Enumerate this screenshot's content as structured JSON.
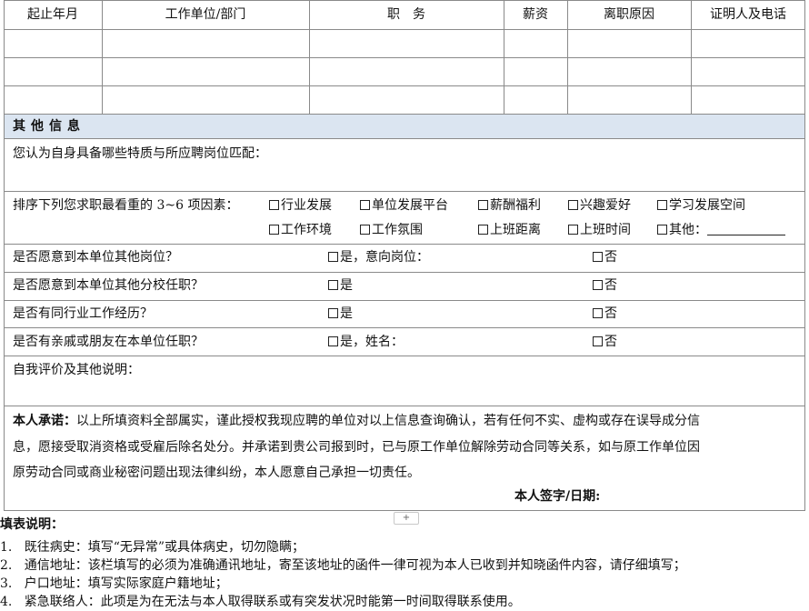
{
  "header_row": {
    "start_date": "起止年月",
    "employer": "工作单位/部门",
    "position": "职　务",
    "salary": "薪资",
    "leave_reason": "离职原因",
    "reference": "证明人及电话"
  },
  "other_info": {
    "title": "其他信息",
    "traits_question": "您认为自身具备哪些特质与所应聘岗位匹配：",
    "factors_question": "排序下列您求职最看重的 3~6 项因素：",
    "factors_row1": [
      "行业发展",
      "单位发展平台",
      "薪酬福利",
      "兴趣爱好",
      "学习发展空间"
    ],
    "factors_row2": [
      "工作环境",
      "工作氛围",
      "上班距离",
      "上班时间",
      "其他："
    ],
    "q1": {
      "label": "是否愿意到本单位其他岗位？",
      "yes": "是，意向岗位：",
      "no": "否"
    },
    "q2": {
      "label": "是否愿意到本单位其他分校任职？",
      "yes": "是",
      "no": "否"
    },
    "q3": {
      "label": "是否有同行业工作经历？",
      "yes": "是",
      "no": "否"
    },
    "q4": {
      "label": "是否有亲戚或朋友在本单位任职？",
      "yes": "是，姓名：",
      "no": "否"
    },
    "self_eval": "自我评价及其他说明：",
    "pledge_label": "本人承诺：",
    "pledge_line1": "以上所填资料全部属实，谨此授权我现应聘的单位对以上信息查询确认，若有任何不实、虚构或存在误导成分信",
    "pledge_line2": "息，愿接受取消资格或受雇后除名处分。并承诺到贵公司报到时，已与原工作单位解除劳动合同等关系，如与原工作单位因",
    "pledge_line3": "原劳动合同或商业秘密问题出现法律纠纷，本人愿意自己承担一切责任。",
    "signature": "本人签字/日期:"
  },
  "notes": {
    "title": "填表说明：",
    "items": [
      {
        "num": "1.",
        "text": "既往病史：填写“无异常”或具体病史，切勿隐瞒；"
      },
      {
        "num": "2.",
        "text": "通信地址：该栏填写的必须为准确通讯地址，寄至该地址的函件一律可视为本人已收到并知晓函件内容，请仔细填写；"
      },
      {
        "num": "3.",
        "text": "户口地址：填写实际家庭户籍地址；"
      },
      {
        "num": "4.",
        "text": "紧急联络人：此项是为在无法与本人取得联系或有突发状况时能第一时间取得联系使用。"
      }
    ]
  },
  "colors": {
    "section_bg": "#dbe5f1",
    "grid": "#8a8a8a"
  }
}
